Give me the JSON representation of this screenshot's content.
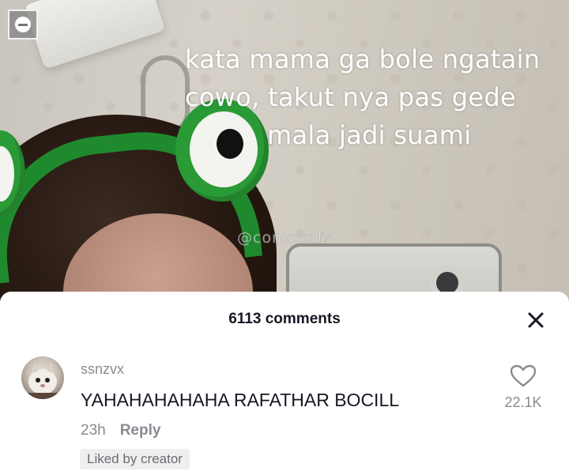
{
  "video": {
    "caption_lines": [
      "kata mama ga bole ngatain",
      "cowo, takut nya pas gede",
      "mala jadi suami"
    ],
    "watermark": "@convomfs"
  },
  "comments_panel": {
    "title": "6113 comments",
    "comment": {
      "username": "ssnzvx",
      "text": "YAHAHAHAHAHA RAFATHAR BOCILL",
      "time": "23h",
      "reply_label": "Reply",
      "badge": "Liked by creator",
      "like_count": "22.1K"
    }
  },
  "colors": {
    "text_primary": "#161823",
    "text_secondary": "#8a8b91",
    "badge_bg": "#efefef"
  },
  "icons": [
    "minimize-icon",
    "close-icon",
    "heart-icon"
  ]
}
